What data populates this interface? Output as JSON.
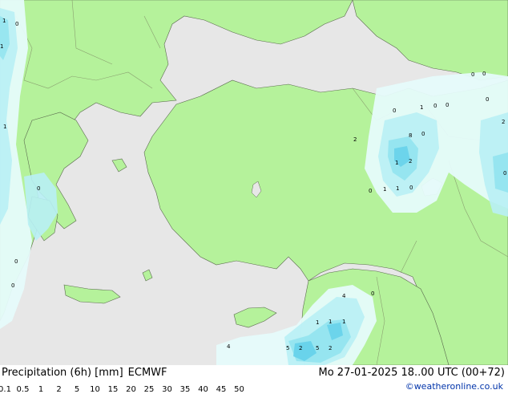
{
  "legend": {
    "title": "Precipitation (6h) [mm]",
    "model": "ECMWF",
    "scale": [
      {
        "label": "0.1",
        "color": "#e6fbfb"
      },
      {
        "label": "0.5",
        "color": "#b8f0f5"
      },
      {
        "label": "1",
        "color": "#8fe3ef"
      },
      {
        "label": "2",
        "color": "#62d0ea"
      },
      {
        "label": "5",
        "color": "#3ab3e0"
      },
      {
        "label": "10",
        "color": "#1e8fd4"
      },
      {
        "label": "15",
        "color": "#1665c6"
      },
      {
        "label": "20",
        "color": "#1a3fb5"
      },
      {
        "label": "25",
        "color": "#2a24a6"
      },
      {
        "label": "30",
        "color": "#4b1aa8"
      },
      {
        "label": "35",
        "color": "#7317b5"
      },
      {
        "label": "40",
        "color": "#a114c2"
      },
      {
        "label": "45",
        "color": "#cc12cc"
      },
      {
        "label": "50",
        "color": "#e01ab8"
      }
    ]
  },
  "valid_time": "Mo 27-01-2025 18..00 UTC (00+72)",
  "credit": "©weatheronline.co.uk",
  "colors": {
    "land": "#b5f29b",
    "sea": "#e7e7e7",
    "border": "#8aa070",
    "coast": "#5a6a4e"
  },
  "precip_values": [
    "1",
    "0",
    "1",
    "1",
    "0",
    "0",
    "0",
    "1",
    "0",
    "0",
    "0",
    "2",
    "8",
    "0",
    "1",
    "2",
    "1",
    "1",
    "0",
    "0",
    "0",
    "0",
    "0",
    "2",
    "0",
    "0",
    "4",
    "1",
    "1",
    "1",
    "4",
    "5",
    "2"
  ]
}
